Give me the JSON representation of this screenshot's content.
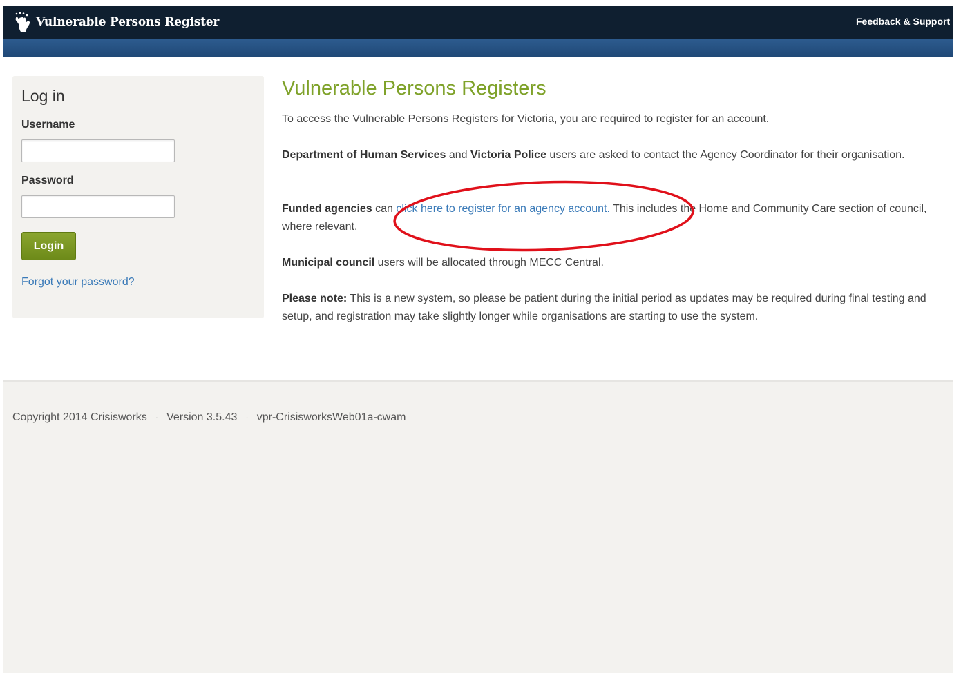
{
  "header": {
    "brand": "Vulnerable Persons Register",
    "brand_icon": "hand-icon",
    "feedback_link": "Feedback & Support"
  },
  "login": {
    "title": "Log in",
    "username_label": "Username",
    "username_value": "",
    "password_label": "Password",
    "password_value": "",
    "login_button": "Login",
    "forgot_link": "Forgot your password?"
  },
  "content": {
    "heading": "Vulnerable Persons Registers",
    "intro": "To access the Vulnerable Persons Registers for Victoria, you are required to register for an account.",
    "p2_bold1": "Department of Human Services",
    "p2_text1": " and ",
    "p2_bold2": "Victoria Police",
    "p2_text2": " users are asked to contact the Agency Coordinator for their organisation.",
    "p3_bold": "Funded agencies",
    "p3_text1": " can ",
    "p3_link": "click here to register for an agency account.",
    "p3_text2": " This includes the Home and Community Care section of council, where relevant.",
    "p4_bold": "Municipal council",
    "p4_text": " users will be allocated through MECC Central.",
    "p5_bold": "Please note:",
    "p5_text": " This is a new system, so please be patient during the initial period as updates may be required during final testing and setup, and registration may take slightly longer while organisations are starting to use the system."
  },
  "footer": {
    "copyright": "Copyright 2014 Crisisworks",
    "version": "Version 3.5.43",
    "server": "vpr-CrisisworksWeb01a-cwam",
    "separator": "·"
  },
  "colors": {
    "navbar": "#0f1f30",
    "subbar": "#2d5b8e",
    "heading_green": "#7fa22a",
    "button_green": "#7a9624",
    "link_blue": "#3a7ab8",
    "annotation_red": "#e0101a"
  }
}
